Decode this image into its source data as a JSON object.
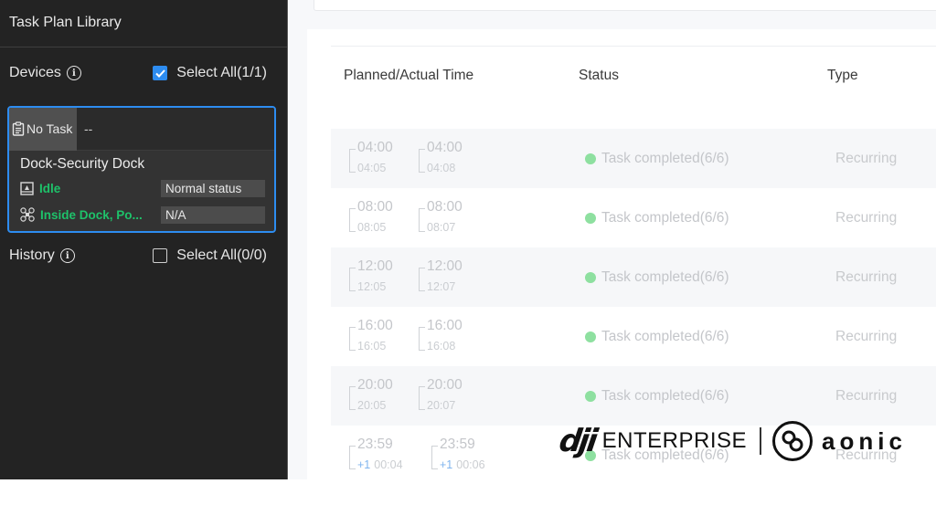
{
  "sidebar": {
    "title": "Task Plan Library",
    "devices": {
      "label": "Devices",
      "info_icon": "info-icon",
      "select_all_label": "Select All(1/1)",
      "select_all_checked": true
    },
    "device_card": {
      "task_icon": "clipboard-icon",
      "task_label": "No Task",
      "task_value": "--",
      "name": "Dock-Security Dock",
      "dock_status_icon": "dock-icon",
      "dock_status": "Idle",
      "dock_status_detail": "Normal status",
      "drone_status_icon": "drone-icon",
      "drone_status": "Inside Dock, Po...",
      "drone_status_detail": "N/A",
      "accent_color": "#2d8cf0",
      "status_color": "#1ec26a"
    },
    "history": {
      "label": "History",
      "info_icon": "info-icon",
      "select_all_label": "Select All(0/0)",
      "select_all_checked": false
    }
  },
  "table": {
    "columns": [
      "Planned/Actual Time",
      "Status",
      "Type"
    ],
    "rows": [
      {
        "planned_start": "04:00",
        "actual_start": "04:05",
        "planned_end": "04:00",
        "actual_end": "04:08",
        "start_day_offset": "",
        "end_day_offset": "",
        "status": "Task completed",
        "status_count": "(6/6)",
        "type": "Recurring"
      },
      {
        "planned_start": "08:00",
        "actual_start": "08:05",
        "planned_end": "08:00",
        "actual_end": "08:07",
        "start_day_offset": "",
        "end_day_offset": "",
        "status": "Task completed",
        "status_count": "(6/6)",
        "type": "Recurring"
      },
      {
        "planned_start": "12:00",
        "actual_start": "12:05",
        "planned_end": "12:00",
        "actual_end": "12:07",
        "start_day_offset": "",
        "end_day_offset": "",
        "status": "Task completed",
        "status_count": "(6/6)",
        "type": "Recurring"
      },
      {
        "planned_start": "16:00",
        "actual_start": "16:05",
        "planned_end": "16:00",
        "actual_end": "16:08",
        "start_day_offset": "",
        "end_day_offset": "",
        "status": "Task completed",
        "status_count": "(6/6)",
        "type": "Recurring"
      },
      {
        "planned_start": "20:00",
        "actual_start": "20:05",
        "planned_end": "20:00",
        "actual_end": "20:07",
        "start_day_offset": "",
        "end_day_offset": "",
        "status": "Task completed",
        "status_count": "(6/6)",
        "type": "Recurring"
      },
      {
        "planned_start": "23:59",
        "actual_start": "00:04",
        "planned_end": "23:59",
        "actual_end": "00:06",
        "start_day_offset": "+1",
        "end_day_offset": "+1",
        "status": "Task completed",
        "status_count": "(6/6)",
        "type": "Recurring"
      }
    ],
    "status_dot_color": "#8ee0a0"
  },
  "watermark": {
    "brand1": "dji",
    "brand1_suffix": "ENTERPRISE",
    "brand2": "aonic"
  }
}
